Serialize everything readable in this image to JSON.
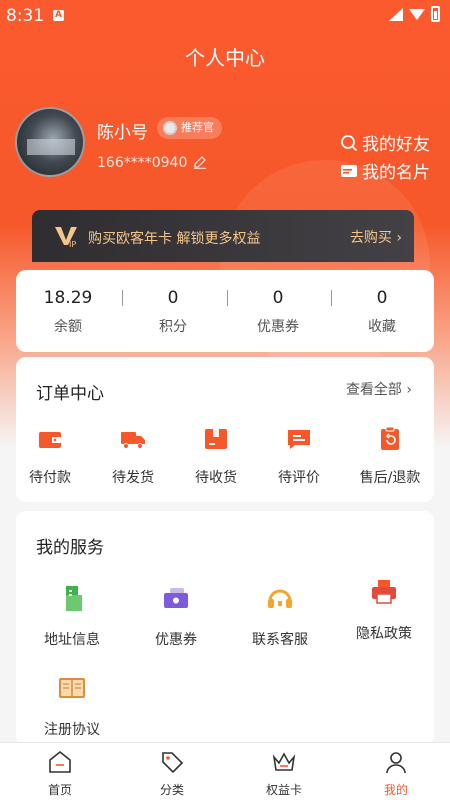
{
  "status_bar": {
    "time": "8:31",
    "a_badge": "A"
  },
  "header": {
    "title": "个人中心"
  },
  "profile": {
    "username": "陈小号",
    "badge": "推荐官",
    "phone": "166****0940",
    "links": {
      "friends": "我的好友",
      "card": "我的名片"
    }
  },
  "vip_banner": {
    "text": "购买欧客年卡 解锁更多权益",
    "action": "去购买 ›"
  },
  "stats": [
    {
      "value": "18.29",
      "label": "余额"
    },
    {
      "value": "0",
      "label": "积分"
    },
    {
      "value": "0",
      "label": "优惠券"
    },
    {
      "value": "0",
      "label": "收藏"
    }
  ],
  "orders": {
    "title": "订单中心",
    "view_all": "查看全部 ›",
    "items": [
      {
        "label": "待付款",
        "icon": "wallet-icon"
      },
      {
        "label": "待发货",
        "icon": "truck-icon"
      },
      {
        "label": "待收货",
        "icon": "box-icon"
      },
      {
        "label": "待评价",
        "icon": "comment-icon"
      },
      {
        "label": "售后/退款",
        "icon": "refund-icon"
      }
    ]
  },
  "services": {
    "title": "我的服务",
    "items": [
      {
        "label": "地址信息",
        "icon": "building-icon"
      },
      {
        "label": "优惠券",
        "icon": "coupon-icon"
      },
      {
        "label": "联系客服",
        "icon": "headset-icon"
      },
      {
        "label": "隐私政策",
        "icon": "printer-icon"
      },
      {
        "label": "注册协议",
        "icon": "book-icon"
      }
    ]
  },
  "tabbar": [
    {
      "label": "首页",
      "icon": "home-icon"
    },
    {
      "label": "分类",
      "icon": "tag-icon"
    },
    {
      "label": "权益卡",
      "icon": "crown-icon"
    },
    {
      "label": "我的",
      "icon": "user-icon",
      "active": true
    }
  ],
  "colors": {
    "accent": "#f6582a",
    "gold": "#f5c68b",
    "vip_bg": "#2f2d30"
  }
}
